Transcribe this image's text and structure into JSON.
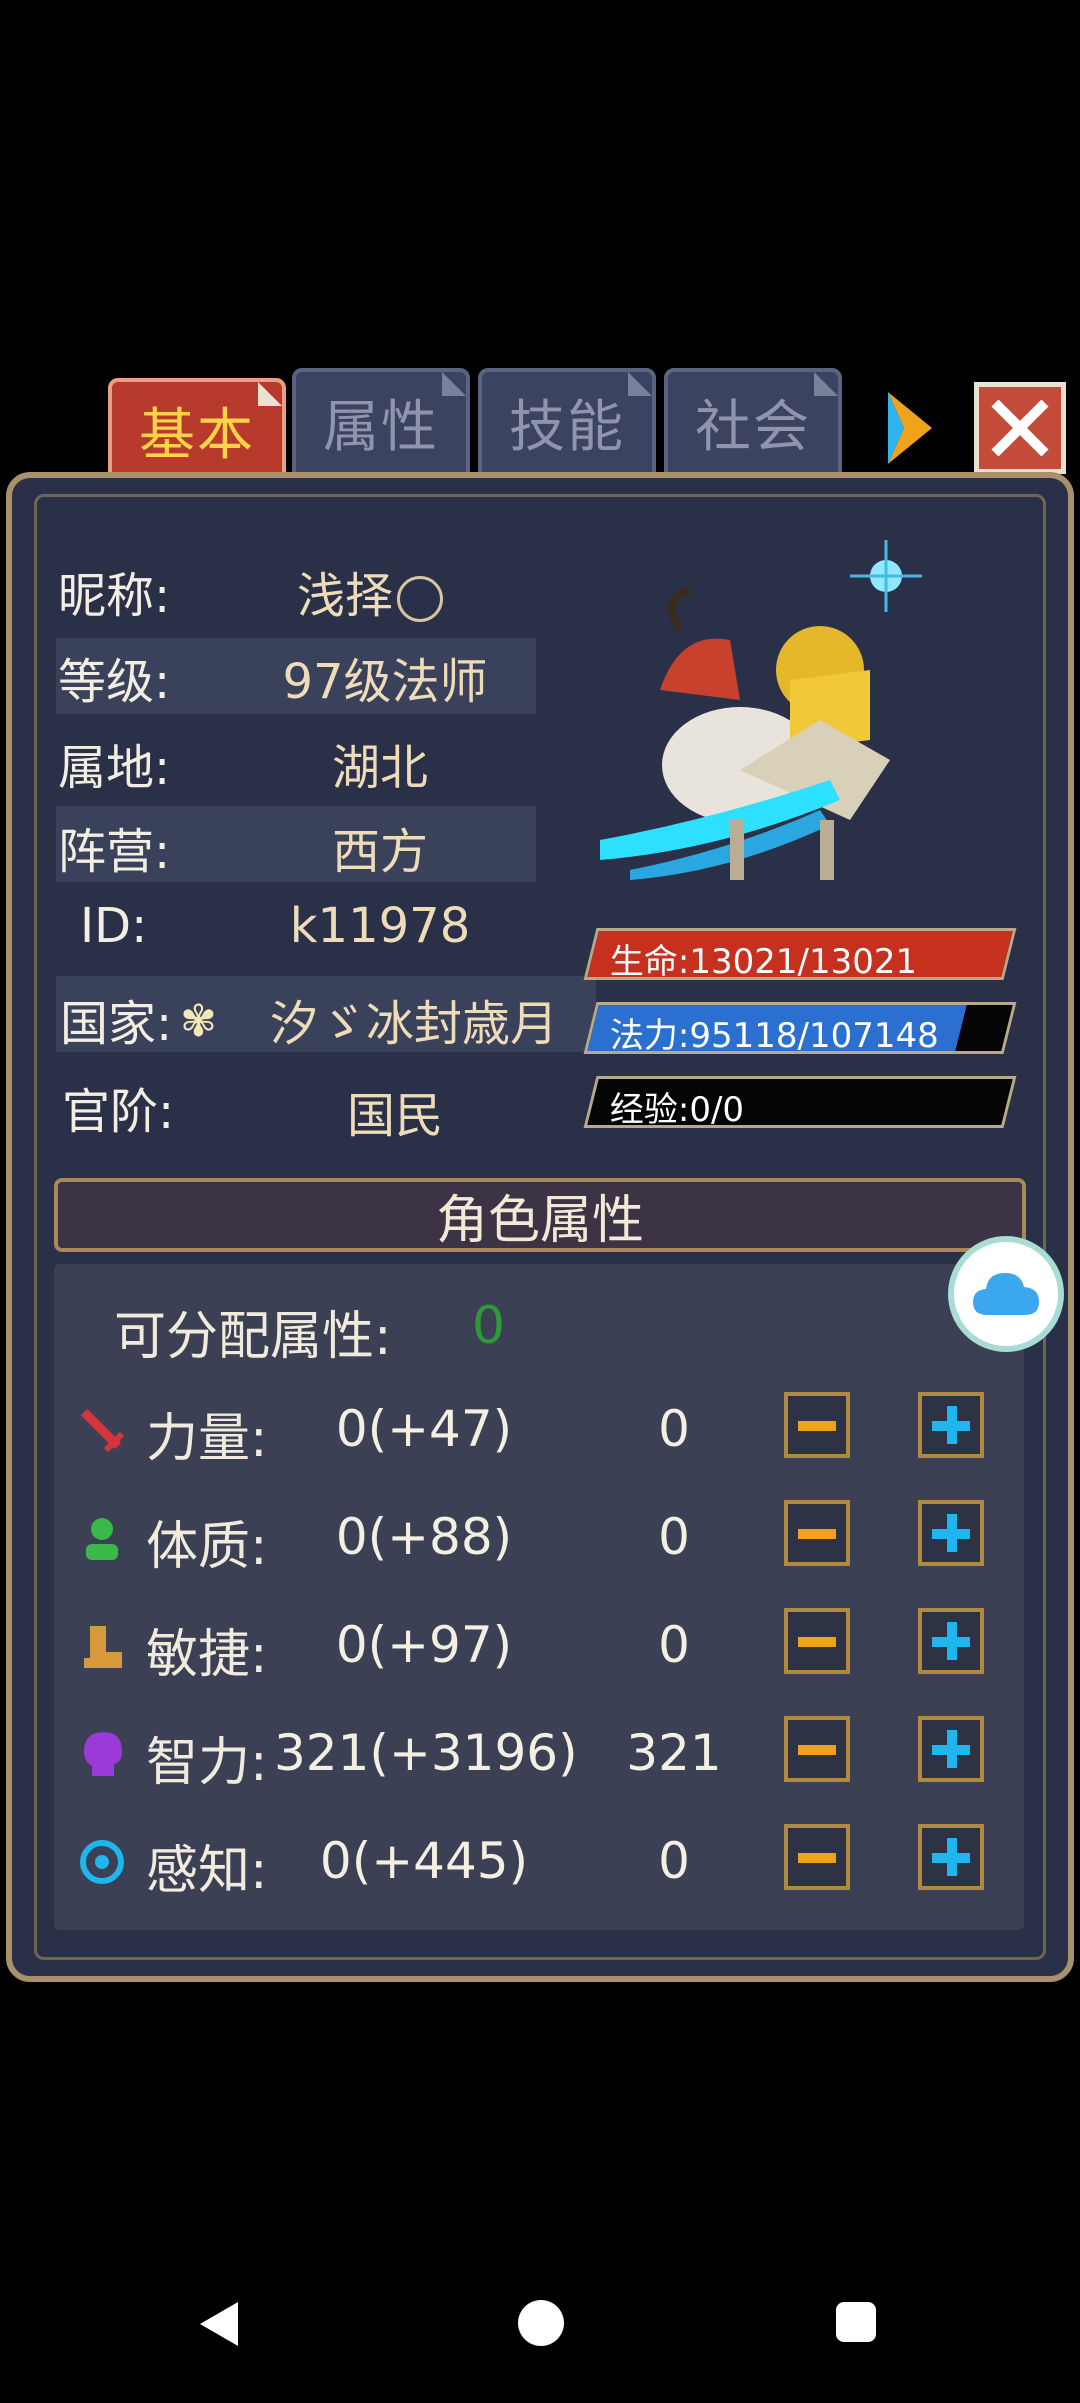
{
  "tabs": [
    {
      "label": "基本",
      "active": true
    },
    {
      "label": "属性",
      "active": false
    },
    {
      "label": "技能",
      "active": false
    },
    {
      "label": "社会",
      "active": false
    }
  ],
  "info": {
    "nickname_label": "昵称:",
    "nickname_value": "浅择",
    "level_label": "等级:",
    "level_value": "97级法师",
    "region_label": "属地:",
    "region_value": "湖北",
    "camp_label": "阵营:",
    "camp_value": "西方",
    "id_label": "ID:",
    "id_value": "k11978",
    "country_label": "国家:",
    "country_value": "汐ゞ冰封歳月",
    "rank_label": "官阶:",
    "rank_value": "国民"
  },
  "bars": {
    "hp": {
      "text": "生命:13021/13021",
      "fraction": 1.0,
      "color": "#c6301f"
    },
    "mp": {
      "text": "法力:95118/107148",
      "fraction": 0.888,
      "color": "#2b6fd0"
    },
    "exp": {
      "text": "经验:0/0",
      "fraction": 0.0,
      "color": "#7a6a3a"
    }
  },
  "attributes": {
    "title": "角色属性",
    "free_label": "可分配属性:",
    "free_value": "0",
    "rows": [
      {
        "name": "力量:",
        "value": "0(+47)",
        "base": "0",
        "icon": "sword-icon"
      },
      {
        "name": "体质:",
        "value": "0(+88)",
        "base": "0",
        "icon": "person-icon"
      },
      {
        "name": "敏捷:",
        "value": "0(+97)",
        "base": "0",
        "icon": "boot-icon"
      },
      {
        "name": "智力:",
        "value": "321(+3196)",
        "base": "321",
        "icon": "head-icon"
      },
      {
        "name": "感知:",
        "value": "0(+445)",
        "base": "0",
        "icon": "eye-target-icon"
      }
    ]
  },
  "colors": {
    "accent_gold": "#ffd34a",
    "free_points_green": "#2f9a3a",
    "plus_blue": "#1fb5ee",
    "minus_orange": "#f0a21a"
  }
}
